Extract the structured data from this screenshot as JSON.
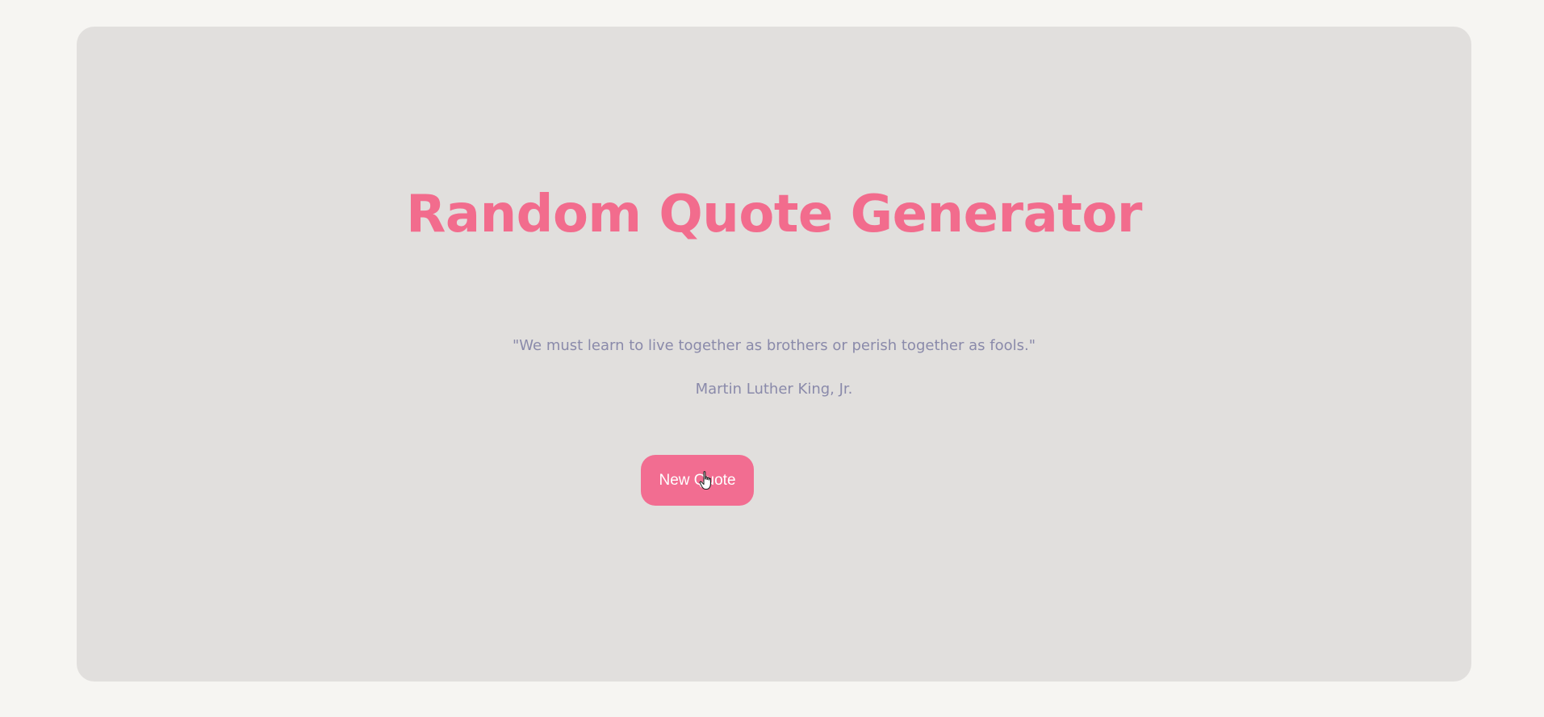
{
  "app": {
    "title": "Random Quote Generator"
  },
  "quote": {
    "text": "\"We must learn to live together as brothers or perish together as fools.\"",
    "author": "Martin Luther King, Jr."
  },
  "actions": {
    "new_quote_label": "New Quote"
  },
  "colors": {
    "page_background": "#f6f5f2",
    "card_background": "#e1dfdd",
    "accent": "#f26c8d",
    "quote_text": "#8a8aaa",
    "button_text": "#ffffff"
  },
  "icons": {
    "cursor": "hand-pointer-icon"
  }
}
